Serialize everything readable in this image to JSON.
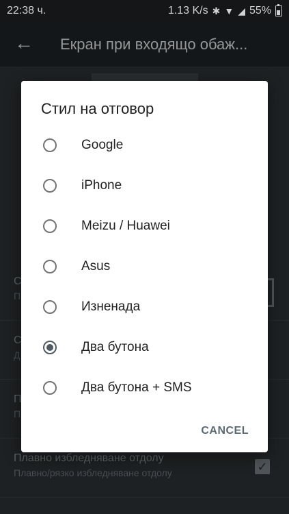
{
  "status_bar": {
    "time": "22:38 ч.",
    "speed": "1.13 K/s",
    "battery": "55%",
    "icons": [
      "bluetooth-icon",
      "wifi-icon",
      "signal-icon",
      "battery-icon"
    ]
  },
  "toolbar": {
    "back_icon": "arrow-left-icon",
    "title": "Екран при входящо обаж..."
  },
  "background": {
    "prefs": [
      {
        "title": "С",
        "subtitle": "П"
      },
      {
        "title": "С",
        "subtitle": "Д"
      },
      {
        "title": "П",
        "subtitle": "П"
      },
      {
        "title": "Плавно избледняване отдолу",
        "subtitle": "Плавно/рязко избледняване отдолу"
      }
    ]
  },
  "dialog": {
    "title": "Стил на отговор",
    "options": [
      {
        "label": "Google",
        "checked": false
      },
      {
        "label": "iPhone",
        "checked": false
      },
      {
        "label": "Meizu / Huawei",
        "checked": false
      },
      {
        "label": "Asus",
        "checked": false
      },
      {
        "label": "Изненада",
        "checked": false
      },
      {
        "label": "Два бутона",
        "checked": true
      },
      {
        "label": "Два бутона + SMS",
        "checked": false
      }
    ],
    "cancel_label": "CANCEL"
  },
  "colors": {
    "accent": "#4e5b63",
    "dialog_bg": "#ffffff",
    "toolbar_bg": "#1f2427"
  }
}
